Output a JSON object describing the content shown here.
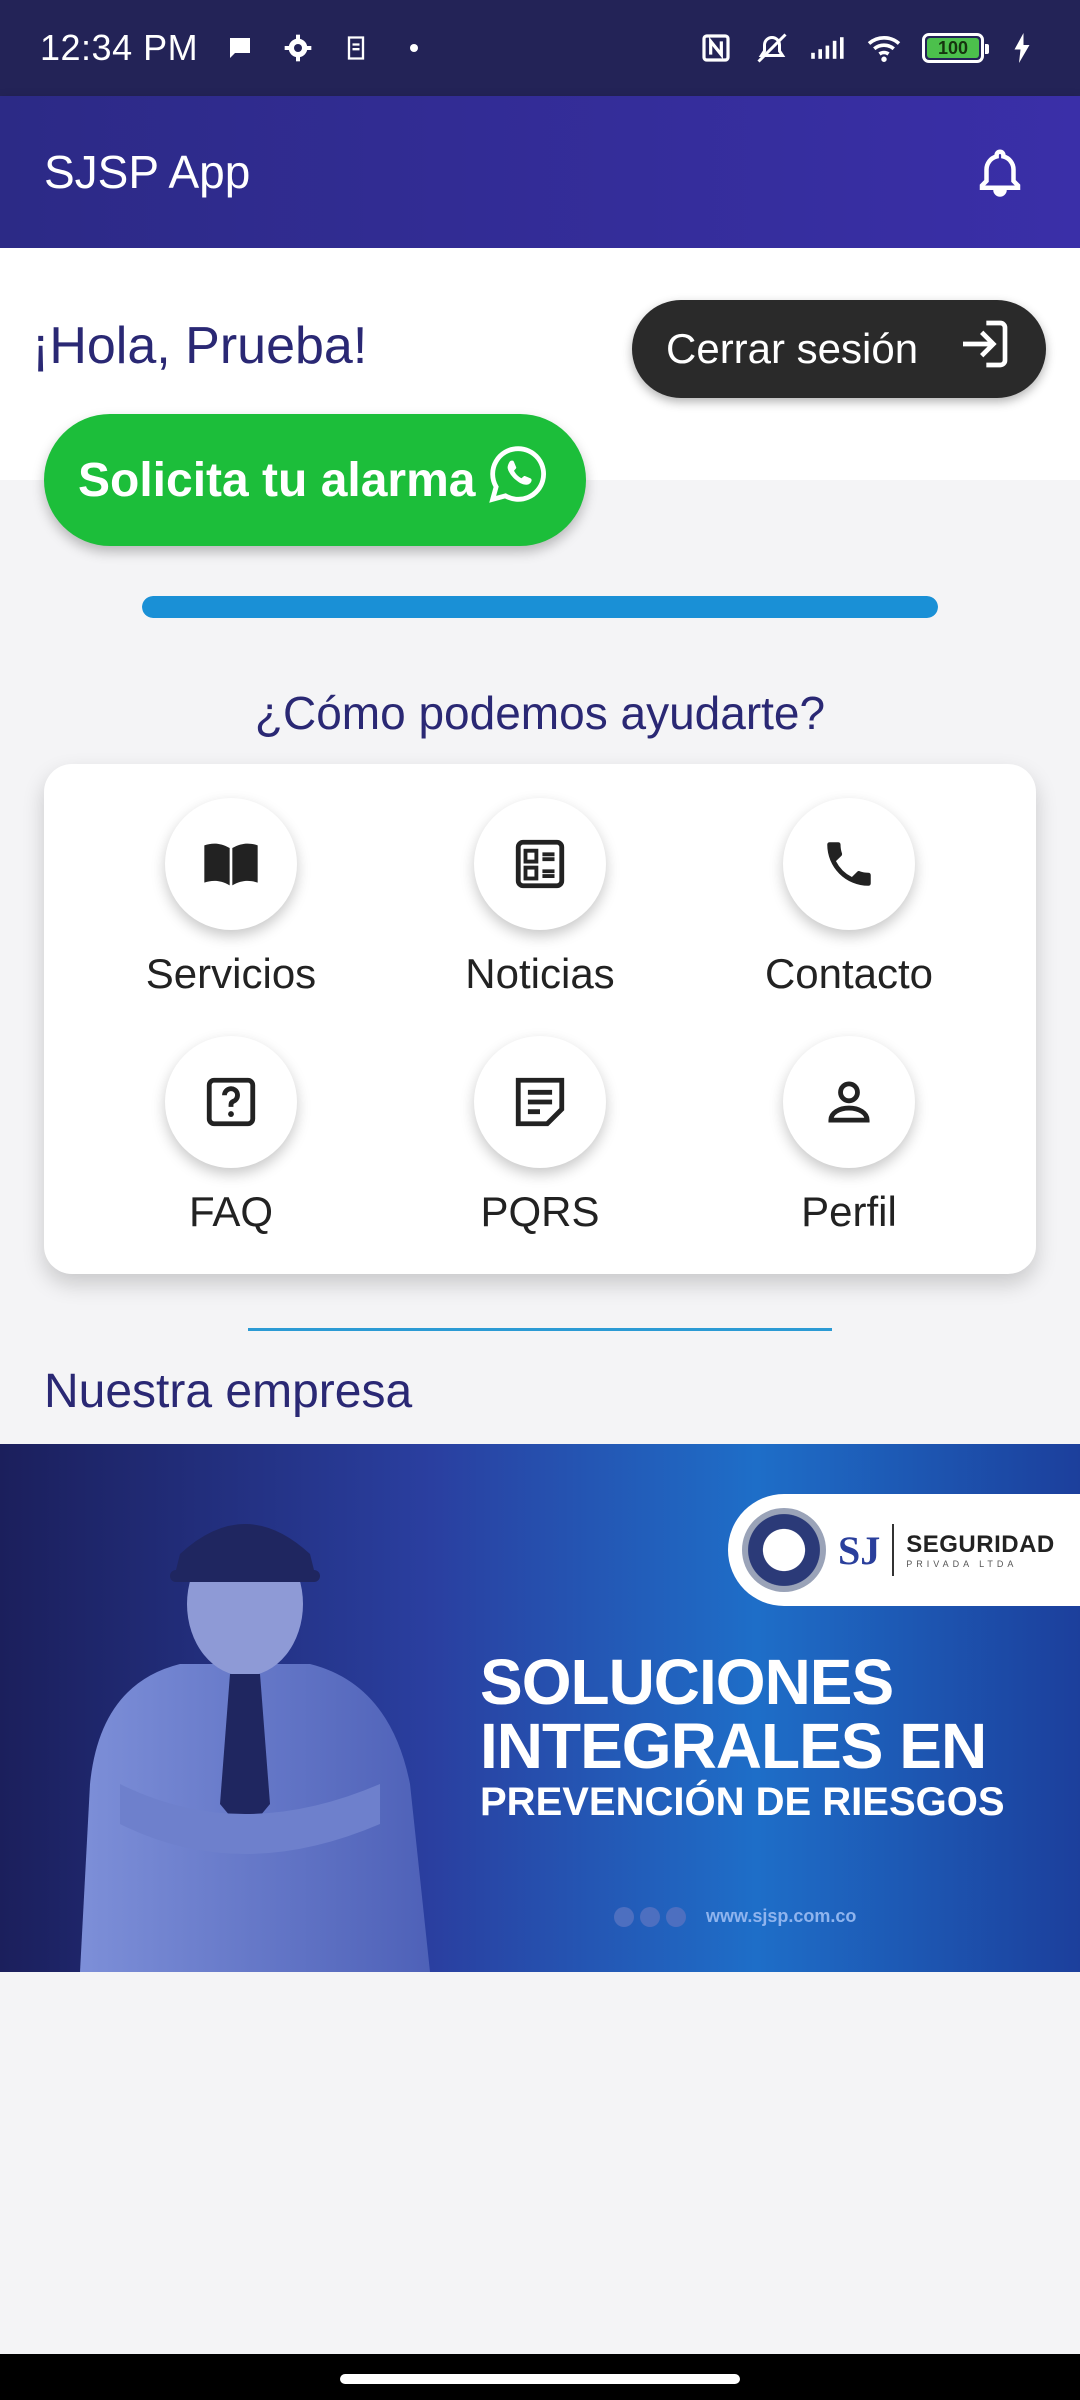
{
  "status_bar": {
    "time": "12:34 PM",
    "battery": "100",
    "icons": [
      "chat-bubble-icon",
      "gear-icon",
      "sim-icon",
      "dot-icon",
      "nfc-icon",
      "mute-icon",
      "signal-icon",
      "wifi-icon",
      "battery-icon",
      "charging-icon"
    ]
  },
  "app_bar": {
    "title": "SJSP App",
    "notification_icon": "bell-icon"
  },
  "header": {
    "greeting": "¡Hola, Prueba!",
    "logout_label": "Cerrar sesión",
    "alarm_label": "Solicita tu alarma",
    "progress": 1.0
  },
  "help": {
    "title": "¿Cómo podemos ayudarte?",
    "items": [
      {
        "label": "Servicios",
        "icon": "book-icon"
      },
      {
        "label": "Noticias",
        "icon": "news-icon"
      },
      {
        "label": "Contacto",
        "icon": "phone-icon"
      },
      {
        "label": "FAQ",
        "icon": "question-icon"
      },
      {
        "label": "PQRS",
        "icon": "note-icon"
      },
      {
        "label": "Perfil",
        "icon": "person-icon"
      }
    ]
  },
  "company": {
    "title": "Nuestra empresa",
    "banner": {
      "logo_initials": "SJ",
      "logo_name": "SEGURIDAD",
      "logo_sub": "PRIVADA LTDA",
      "headline_1": "SOLUCIONES",
      "headline_2": "INTEGRALES EN",
      "headline_3": "PREVENCIÓN DE RIESGOS",
      "url": "www.sjsp.com.co"
    }
  },
  "colors": {
    "status_bar": "#232357",
    "app_bar": "#3a2fa8",
    "accent_text": "#2a2874",
    "alarm_green": "#1cbe3a",
    "progress_blue": "#1a90d6",
    "logout_dark": "#2a2a2a"
  }
}
